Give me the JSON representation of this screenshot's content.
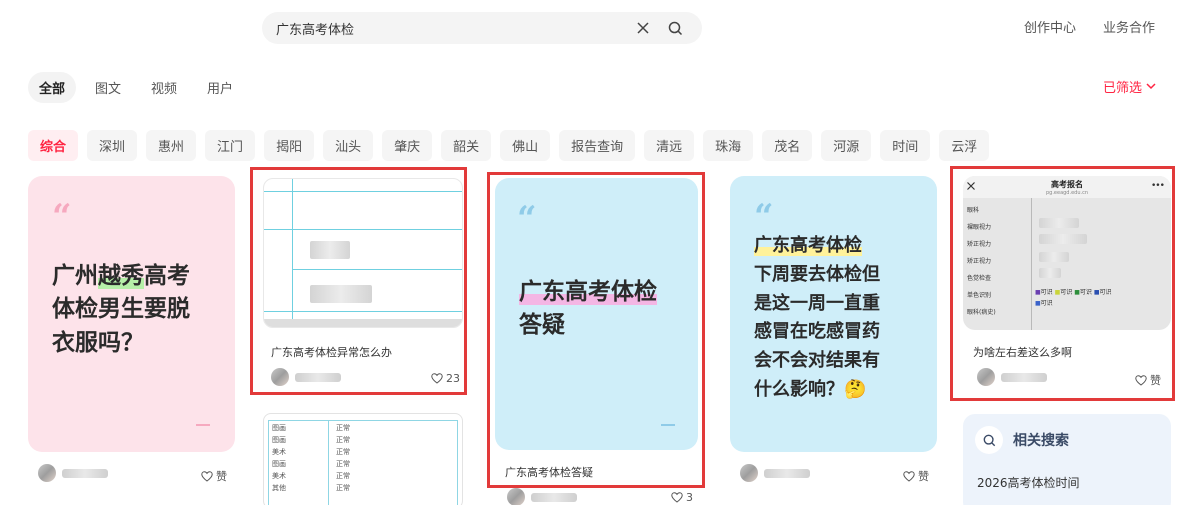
{
  "search": {
    "query": "广东高考体检"
  },
  "header": {
    "creator_center": "创作中心",
    "business": "业务合作"
  },
  "type_tabs": [
    "全部",
    "图文",
    "视频",
    "用户"
  ],
  "filter_label": "已筛选",
  "chips": [
    "综合",
    "深圳",
    "惠州",
    "江门",
    "揭阳",
    "汕头",
    "肇庆",
    "韶关",
    "佛山",
    "报告查询",
    "清远",
    "珠海",
    "茂名",
    "河源",
    "时间",
    "云浮"
  ],
  "notes": {
    "n1": {
      "cover_lines": [
        "广州越秀高考",
        "体检男生要脱",
        "衣服吗？"
      ],
      "highlight": "越秀",
      "like": "赞"
    },
    "n2": {
      "title": "广东高考体检异常怎么办",
      "like": "23"
    },
    "n3": {
      "cover_lines": [
        "广东高考体检",
        "答疑"
      ],
      "title": "广东高考体检答疑",
      "like": "3"
    },
    "n4": {
      "cover_lines": [
        "广东高考体检",
        "下周要去体检但",
        "是这一周一直重",
        "感冒在吃感冒药",
        "会不会对结果有",
        "什么影响？🤔"
      ],
      "like": "赞"
    },
    "n5": {
      "title": "为啥左右差这么多啊",
      "like": "赞",
      "form": {
        "header": "高考报名",
        "site": "pg.eeagd.edu.cn",
        "rows": [
          "眼科",
          "裸眼视力",
          "矫正视力",
          "矫正视力",
          "色觉检查",
          "单色识别",
          "眼科(病史)"
        ],
        "color_opts": [
          "可识",
          "可识",
          "可识",
          "可识",
          "可识"
        ]
      }
    },
    "n6": {
      "rows": [
        "图画",
        "图画",
        "美术",
        "图画",
        "美术",
        "其他"
      ],
      "vals": [
        "正常",
        "正常",
        "正常",
        "正常",
        "正常",
        "正常"
      ]
    }
  },
  "related": {
    "title": "相关搜索",
    "items": [
      "2026高考体检时间"
    ]
  },
  "colors": {
    "accent": "#ff2442",
    "box": "#e23a3a"
  }
}
